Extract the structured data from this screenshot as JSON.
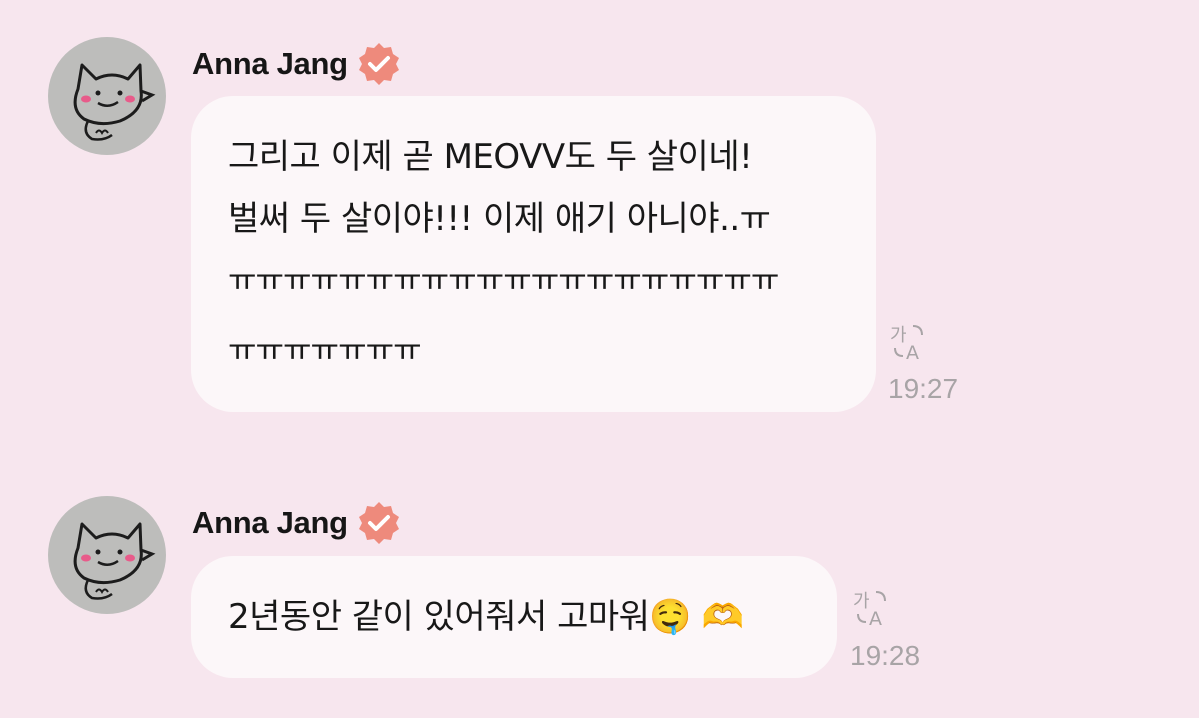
{
  "messages": [
    {
      "sender": "Anna Jang",
      "lines": [
        "그리고 이제 곧 MEOVV도 두 살이네!",
        "벌써 두 살이야!!! 이제 애기 아니야..ㅠ",
        "ㅠㅠㅠㅠㅠㅠㅠㅠㅠㅠㅠㅠㅠㅠㅠㅠㅠㅠㅠㅠ",
        "ㅠㅠㅠㅠㅠㅠㅠ"
      ],
      "time": "19:27"
    },
    {
      "sender": "Anna Jang",
      "lines": [
        "2년동안 같이 있어줘서 고마워🤤 🫶"
      ],
      "time": "19:28"
    }
  ],
  "icons": {
    "verified": "verified-badge-icon",
    "translate": "translate-icon"
  },
  "colors": {
    "background": "#f7e6ee",
    "bubble": "#fcf7f9",
    "verified_badge": "#ee8a7c",
    "timestamp": "#a8a4a6"
  }
}
